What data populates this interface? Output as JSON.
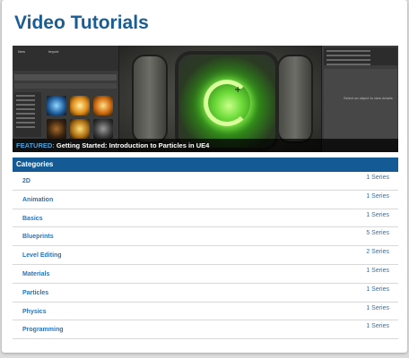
{
  "page": {
    "title": "Video Tutorials"
  },
  "featured": {
    "label": "FEATURED:",
    "title": "Getting Started: Introduction to Particles in UE4",
    "editor_hint": "Select an object to view details",
    "panel_caption_1": "New",
    "panel_caption_2": "Import"
  },
  "categories": {
    "header": "Categories",
    "items": [
      {
        "name": "2D",
        "count": "1 Series"
      },
      {
        "name": "Animation",
        "count": "1 Series"
      },
      {
        "name": "Basics",
        "count": "1 Series"
      },
      {
        "name": "Blueprints",
        "count": "5 Series"
      },
      {
        "name": "Level Editing",
        "count": "2 Series"
      },
      {
        "name": "Materials",
        "count": "1 Series"
      },
      {
        "name": "Particles",
        "count": "1 Series"
      },
      {
        "name": "Physics",
        "count": "1 Series"
      },
      {
        "name": "Programming",
        "count": "1 Series"
      }
    ]
  },
  "colors": {
    "title": "#1a5d93",
    "header_bg": "#145a94",
    "link": "#2a73b8",
    "featured_label": "#4aa3e0"
  }
}
